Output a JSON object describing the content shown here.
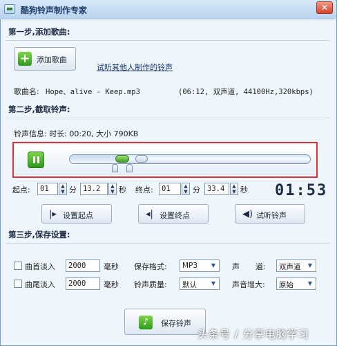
{
  "window": {
    "title": "酷狗铃声制作专家",
    "close_glyph": "✕"
  },
  "step1": {
    "title": "第一步,添加歌曲:",
    "add_song_label": "添加歌曲",
    "add_icon": "+",
    "others_link": "试听其他人制作的铃声",
    "song_name_label": "歌曲名:",
    "song_name": "Hope、alive - Keep.mp3",
    "song_info": "(06:12, 双声道, 44100Hz,320kbps)"
  },
  "step2": {
    "title": "第二步,截取铃声:",
    "ringtone_info": "铃声信息: 时长: 00:20, 大小 790KB",
    "play_state": "paused",
    "progress_fraction": 0.2,
    "start_label": "起点:",
    "start_min": "01",
    "start_sec": "13.2",
    "end_label": "终点:",
    "end_min": "01",
    "end_sec": "33.4",
    "min_unit": "分",
    "sec_unit": "秒",
    "clock": "01:53",
    "btn_set_start": "设置起点",
    "btn_set_end": "设置终点",
    "btn_preview": "试听铃声",
    "icon_set_start": "|▸",
    "icon_set_end": "◂|",
    "icon_preview": "◀)"
  },
  "step3": {
    "title": "第三步,保存设置:",
    "fade_in_label": "曲首淡入",
    "fade_in_value": "2000",
    "fade_out_label": "曲尾淡入",
    "fade_out_value": "2000",
    "ms_unit": "毫秒",
    "format_label": "保存格式:",
    "format_value": "MP3",
    "channel_label": "声",
    "channel_label2": "道:",
    "channel_value": "双声道",
    "quality_label": "铃声质量:",
    "quality_value": "默认",
    "volume_label": "声音增大:",
    "volume_value": "原始"
  },
  "save": {
    "label": "保存铃声",
    "icon": "♪"
  },
  "watermark": "头条号 / 分享电脑学习",
  "colors": {
    "accent_green": "#2d9a1a",
    "highlight_frame": "#e23131",
    "title_text": "#1f3f6a"
  }
}
